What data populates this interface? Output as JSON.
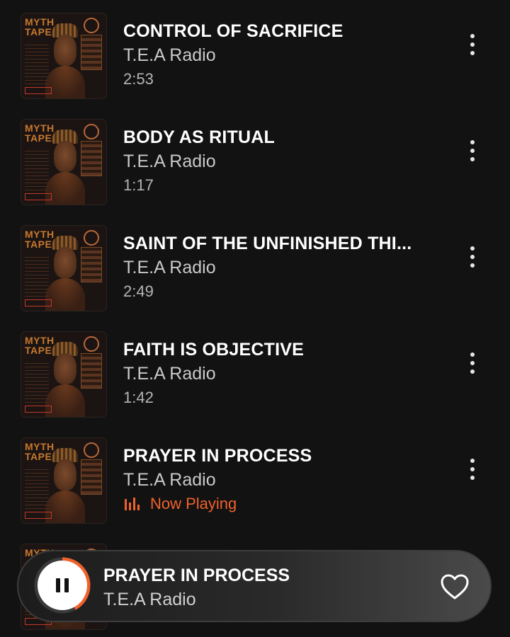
{
  "tracks": [
    {
      "title": "CONTROL OF SACRIFICE",
      "artist": "T.E.A Radio",
      "duration": "2:53",
      "art_text": "MYTH TAPES"
    },
    {
      "title": "BODY AS RITUAL",
      "artist": "T.E.A Radio",
      "duration": "1:17",
      "art_text": "MYTH TAPES"
    },
    {
      "title": "SAINT OF THE UNFINISHED THI...",
      "artist": "T.E.A Radio",
      "duration": "2:49",
      "art_text": "MYTH TAPES"
    },
    {
      "title": "FAITH IS OBJECTIVE",
      "artist": "T.E.A Radio",
      "duration": "1:42",
      "art_text": "MYTH TAPES"
    },
    {
      "title": "PRAYER IN PROCESS",
      "artist": "T.E.A Radio",
      "status": "Now Playing",
      "art_text": "MYTH TAPES"
    },
    {
      "art_text": "MYTH"
    }
  ],
  "player": {
    "title": "PRAYER IN PROCESS",
    "artist": "T.E.A Radio",
    "progress": 0.42,
    "icons": {
      "play": "pause-icon",
      "favorite": "heart-outline-icon"
    }
  },
  "colors": {
    "background": "#121212",
    "accent": "#f0612b",
    "text_primary": "#ffffff",
    "text_secondary": "#c9c9c9"
  }
}
